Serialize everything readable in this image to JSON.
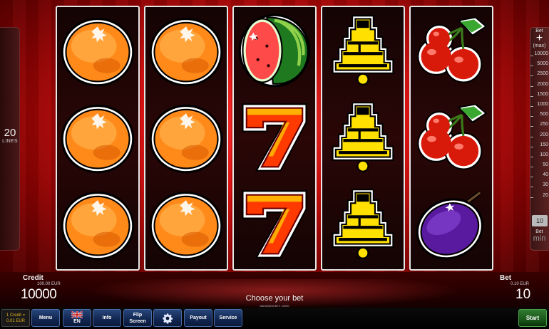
{
  "lines": {
    "count": "20",
    "label": "LINES"
  },
  "reels": [
    [
      "orange-icon",
      "orange-icon",
      "orange-icon"
    ],
    [
      "orange-icon",
      "orange-icon",
      "orange-icon"
    ],
    [
      "watermelon-icon",
      "seven-icon",
      "seven-icon"
    ],
    [
      "bell-icon",
      "bell-icon",
      "bell-icon"
    ],
    [
      "cherries-icon",
      "cherries-icon",
      "plum-icon"
    ]
  ],
  "bet_rail": {
    "top_label": "Bet",
    "plus": "+",
    "max_label": "(max)",
    "ticks": [
      "10000",
      "5000",
      "2500",
      "2000",
      "1500",
      "1000",
      "500",
      "250",
      "200",
      "150",
      "100",
      "50",
      "40",
      "30",
      "20"
    ],
    "selected": "10",
    "bottom_label": "Bet",
    "min_label": "min"
  },
  "credit": {
    "title": "Credit",
    "sub": "100.00 EUR",
    "value": "10000"
  },
  "bet": {
    "title": "Bet",
    "sub": "0.10 EUR",
    "value": "10"
  },
  "message": {
    "main": "Choose your bet",
    "sub": "MAXIMUM BET: 10000"
  },
  "toolbar": {
    "credit_info_line1": "1 Credit =",
    "credit_info_line2": "0.01 EUR",
    "menu": "Menu",
    "language": "EN",
    "info": "Info",
    "flip_line1": "Flip",
    "flip_line2": "Screen",
    "payout": "Payout",
    "service": "Service",
    "start": "Start"
  }
}
